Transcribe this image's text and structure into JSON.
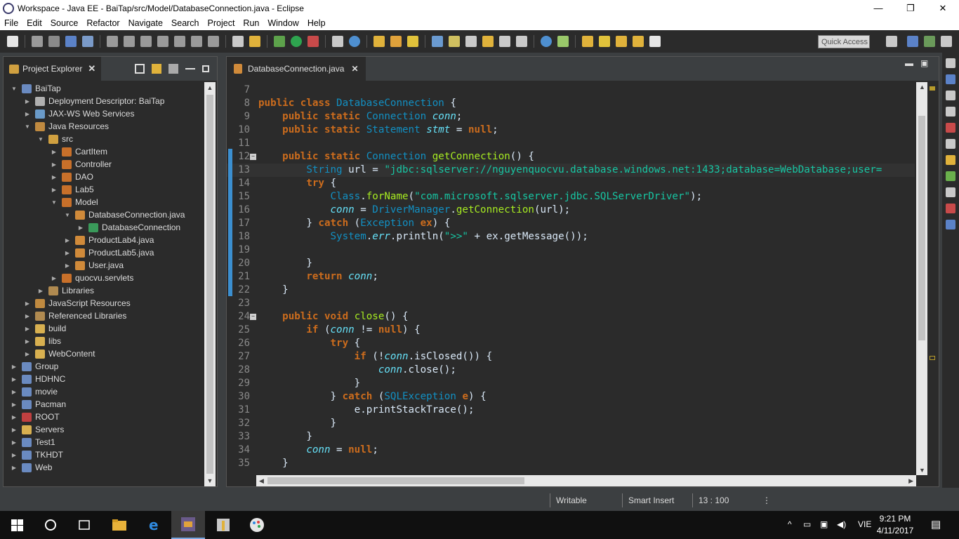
{
  "window": {
    "title": "Workspace - Java EE - BaiTap/src/Model/DatabaseConnection.java - Eclipse",
    "minimize": "—",
    "restore": "❐",
    "close": "✕"
  },
  "menu": [
    "File",
    "Edit",
    "Source",
    "Refactor",
    "Navigate",
    "Search",
    "Project",
    "Run",
    "Window",
    "Help"
  ],
  "toolbar": {
    "quick_access_placeholder": "Quick Access"
  },
  "project_explorer": {
    "tab_label": "Project Explorer",
    "items": [
      {
        "label": "BaiTap",
        "depth": 0,
        "twisty": "▼",
        "icon": "project-icon"
      },
      {
        "label": "Deployment Descriptor: BaiTap",
        "depth": 1,
        "twisty": "▶",
        "icon": "descriptor-icon"
      },
      {
        "label": "JAX-WS Web Services",
        "depth": 1,
        "twisty": "▶",
        "icon": "webservice-icon"
      },
      {
        "label": "Java Resources",
        "depth": 1,
        "twisty": "▼",
        "icon": "java-resources-icon"
      },
      {
        "label": "src",
        "depth": 2,
        "twisty": "▼",
        "icon": "source-folder-icon"
      },
      {
        "label": "CartItem",
        "depth": 3,
        "twisty": "▶",
        "icon": "package-icon"
      },
      {
        "label": "Controller",
        "depth": 3,
        "twisty": "▶",
        "icon": "package-icon"
      },
      {
        "label": "DAO",
        "depth": 3,
        "twisty": "▶",
        "icon": "package-icon"
      },
      {
        "label": "Lab5",
        "depth": 3,
        "twisty": "▶",
        "icon": "package-icon"
      },
      {
        "label": "Model",
        "depth": 3,
        "twisty": "▼",
        "icon": "package-icon"
      },
      {
        "label": "DatabaseConnection.java",
        "depth": 4,
        "twisty": "▼",
        "icon": "java-file-icon"
      },
      {
        "label": "DatabaseConnection",
        "depth": 5,
        "twisty": "▶",
        "icon": "class-icon"
      },
      {
        "label": "ProductLab4.java",
        "depth": 4,
        "twisty": "▶",
        "icon": "java-file-icon"
      },
      {
        "label": "ProductLab5.java",
        "depth": 4,
        "twisty": "▶",
        "icon": "java-file-icon"
      },
      {
        "label": "User.java",
        "depth": 4,
        "twisty": "▶",
        "icon": "java-file-icon"
      },
      {
        "label": "quocvu.servlets",
        "depth": 3,
        "twisty": "▶",
        "icon": "package-icon"
      },
      {
        "label": "Libraries",
        "depth": 2,
        "twisty": "▶",
        "icon": "library-icon"
      },
      {
        "label": "JavaScript Resources",
        "depth": 1,
        "twisty": "▶",
        "icon": "js-resources-icon"
      },
      {
        "label": "Referenced Libraries",
        "depth": 1,
        "twisty": "▶",
        "icon": "library-icon"
      },
      {
        "label": "build",
        "depth": 1,
        "twisty": "▶",
        "icon": "folder-icon"
      },
      {
        "label": "libs",
        "depth": 1,
        "twisty": "▶",
        "icon": "folder-icon"
      },
      {
        "label": "WebContent",
        "depth": 1,
        "twisty": "▶",
        "icon": "folder-icon"
      },
      {
        "label": "Group",
        "depth": 0,
        "twisty": "▶",
        "icon": "project-icon"
      },
      {
        "label": "HDHNC",
        "depth": 0,
        "twisty": "▶",
        "icon": "project-icon"
      },
      {
        "label": "movie",
        "depth": 0,
        "twisty": "▶",
        "icon": "project-icon"
      },
      {
        "label": "Pacman",
        "depth": 0,
        "twisty": "▶",
        "icon": "project-icon"
      },
      {
        "label": "ROOT",
        "depth": 0,
        "twisty": "▶",
        "icon": "project-error-icon"
      },
      {
        "label": "Servers",
        "depth": 0,
        "twisty": "▶",
        "icon": "folder-icon"
      },
      {
        "label": "Test1",
        "depth": 0,
        "twisty": "▶",
        "icon": "project-icon"
      },
      {
        "label": "TKHDT",
        "depth": 0,
        "twisty": "▶",
        "icon": "project-icon"
      },
      {
        "label": "Web",
        "depth": 0,
        "twisty": "▶",
        "icon": "project-icon"
      }
    ]
  },
  "editor": {
    "tab_label": "DatabaseConnection.java",
    "current_line": 13,
    "lines": [
      {
        "n": "7",
        "tokens": []
      },
      {
        "n": "8",
        "tokens": [
          [
            "kw",
            "public "
          ],
          [
            "kw",
            "class "
          ],
          [
            "ty",
            "DatabaseConnection"
          ],
          [
            "wht",
            " {"
          ]
        ]
      },
      {
        "n": "9",
        "tokens": [
          [
            "wht",
            "    "
          ],
          [
            "kw",
            "public "
          ],
          [
            "kw",
            "static "
          ],
          [
            "ty",
            "Connection "
          ],
          [
            "fld",
            "conn"
          ],
          [
            "wht",
            ";"
          ]
        ]
      },
      {
        "n": "10",
        "tokens": [
          [
            "wht",
            "    "
          ],
          [
            "kw",
            "public "
          ],
          [
            "kw",
            "static "
          ],
          [
            "ty",
            "Statement "
          ],
          [
            "fld",
            "stmt"
          ],
          [
            "wht",
            " = "
          ],
          [
            "kw",
            "null"
          ],
          [
            "wht",
            ";"
          ]
        ]
      },
      {
        "n": "11",
        "tokens": []
      },
      {
        "n": "12",
        "fold": true,
        "tokens": [
          [
            "wht",
            "    "
          ],
          [
            "kw",
            "public "
          ],
          [
            "kw",
            "static "
          ],
          [
            "ty",
            "Connection "
          ],
          [
            "mth",
            "getConnection"
          ],
          [
            "wht",
            "() {"
          ]
        ]
      },
      {
        "n": "13",
        "tokens": [
          [
            "wht",
            "        "
          ],
          [
            "ty",
            "String "
          ],
          [
            "wht",
            "url = "
          ],
          [
            "str",
            "\"jdbc:sqlserver://nguyenquocvu.database.windows.net:1433;database=WebDatabase;user="
          ]
        ]
      },
      {
        "n": "14",
        "tokens": [
          [
            "wht",
            "        "
          ],
          [
            "kw",
            "try "
          ],
          [
            "wht",
            "{"
          ]
        ]
      },
      {
        "n": "15",
        "tokens": [
          [
            "wht",
            "            "
          ],
          [
            "ty",
            "Class"
          ],
          [
            "wht",
            "."
          ],
          [
            "pur",
            "forName"
          ],
          [
            "wht",
            "("
          ],
          [
            "str",
            "\"com.microsoft.sqlserver.jdbc.SQLServerDriver\""
          ],
          [
            "wht",
            ");"
          ]
        ]
      },
      {
        "n": "16",
        "tokens": [
          [
            "wht",
            "            "
          ],
          [
            "fld",
            "conn"
          ],
          [
            "wht",
            " = "
          ],
          [
            "ty",
            "DriverManager"
          ],
          [
            "wht",
            "."
          ],
          [
            "pur",
            "getConnection"
          ],
          [
            "wht",
            "(url);"
          ]
        ]
      },
      {
        "n": "17",
        "tokens": [
          [
            "wht",
            "        } "
          ],
          [
            "kw",
            "catch "
          ],
          [
            "wht",
            "("
          ],
          [
            "ty",
            "Exception "
          ],
          [
            "kw",
            "ex"
          ],
          [
            "wht",
            ") {"
          ]
        ]
      },
      {
        "n": "18",
        "tokens": [
          [
            "wht",
            "            "
          ],
          [
            "ty",
            "System"
          ],
          [
            "wht",
            "."
          ],
          [
            "fld",
            "err"
          ],
          [
            "wht",
            ".println("
          ],
          [
            "str",
            "\">>\""
          ],
          [
            "wht",
            " + ex.getMessage());"
          ]
        ]
      },
      {
        "n": "19",
        "tokens": []
      },
      {
        "n": "20",
        "tokens": [
          [
            "wht",
            "        }"
          ]
        ]
      },
      {
        "n": "21",
        "tokens": [
          [
            "wht",
            "        "
          ],
          [
            "kw",
            "return "
          ],
          [
            "fld",
            "conn"
          ],
          [
            "wht",
            ";"
          ]
        ]
      },
      {
        "n": "22",
        "tokens": [
          [
            "wht",
            "    }"
          ]
        ]
      },
      {
        "n": "23",
        "tokens": []
      },
      {
        "n": "24",
        "fold": true,
        "tokens": [
          [
            "wht",
            "    "
          ],
          [
            "kw",
            "public "
          ],
          [
            "kw",
            "void "
          ],
          [
            "mth",
            "close"
          ],
          [
            "wht",
            "() {"
          ]
        ]
      },
      {
        "n": "25",
        "tokens": [
          [
            "wht",
            "        "
          ],
          [
            "kw",
            "if "
          ],
          [
            "wht",
            "("
          ],
          [
            "fld",
            "conn"
          ],
          [
            "wht",
            " != "
          ],
          [
            "kw",
            "null"
          ],
          [
            "wht",
            ") {"
          ]
        ]
      },
      {
        "n": "26",
        "tokens": [
          [
            "wht",
            "            "
          ],
          [
            "kw",
            "try "
          ],
          [
            "wht",
            "{"
          ]
        ]
      },
      {
        "n": "27",
        "tokens": [
          [
            "wht",
            "                "
          ],
          [
            "kw",
            "if "
          ],
          [
            "wht",
            "(!"
          ],
          [
            "fld",
            "conn"
          ],
          [
            "wht",
            ".isClosed()) {"
          ]
        ]
      },
      {
        "n": "28",
        "tokens": [
          [
            "wht",
            "                    "
          ],
          [
            "fld",
            "conn"
          ],
          [
            "wht",
            ".close();"
          ]
        ]
      },
      {
        "n": "29",
        "tokens": [
          [
            "wht",
            "                }"
          ]
        ]
      },
      {
        "n": "30",
        "tokens": [
          [
            "wht",
            "            } "
          ],
          [
            "kw",
            "catch "
          ],
          [
            "wht",
            "("
          ],
          [
            "ty",
            "SQLException "
          ],
          [
            "kw",
            "e"
          ],
          [
            "wht",
            ") {"
          ]
        ]
      },
      {
        "n": "31",
        "tokens": [
          [
            "wht",
            "                e.printStackTrace();"
          ]
        ]
      },
      {
        "n": "32",
        "tokens": [
          [
            "wht",
            "            }"
          ]
        ]
      },
      {
        "n": "33",
        "tokens": [
          [
            "wht",
            "        }"
          ]
        ]
      },
      {
        "n": "34",
        "tokens": [
          [
            "wht",
            "        "
          ],
          [
            "fld",
            "conn"
          ],
          [
            "wht",
            " = "
          ],
          [
            "kw",
            "null"
          ],
          [
            "wht",
            ";"
          ]
        ]
      },
      {
        "n": "35",
        "tokens": [
          [
            "wht",
            "    }"
          ]
        ]
      }
    ]
  },
  "status": {
    "writable": "Writable",
    "insert_mode": "Smart Insert",
    "position": "13 : 100"
  },
  "taskbar": {
    "time": "9:21 PM",
    "date": "4/11/2017",
    "language": "VIE"
  },
  "colors": {
    "editor_bg": "#2b2b2b",
    "keyword": "#cc6c1d",
    "type": "#1290c3",
    "field": "#66e1f8",
    "string": "#17c6a3",
    "method": "#a7ec21"
  }
}
